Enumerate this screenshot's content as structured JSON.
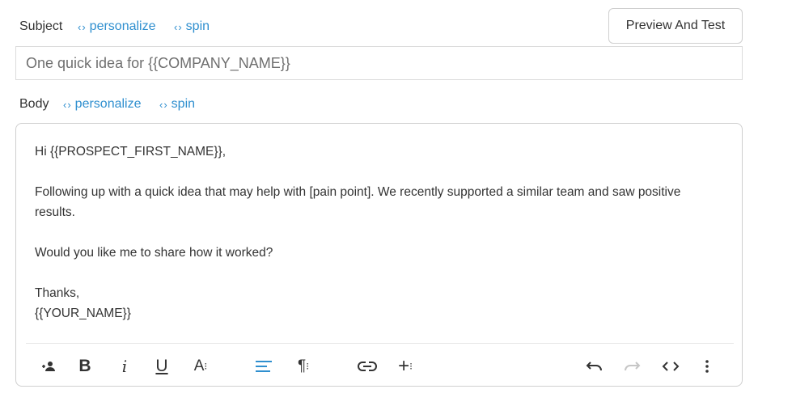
{
  "subject": {
    "label": "Subject",
    "personalize_label": "personalize",
    "spin_label": "spin",
    "value": "One quick idea for {{COMPANY_NAME}}"
  },
  "preview_button": {
    "label": "Preview And Test"
  },
  "body": {
    "label": "Body",
    "personalize_label": "personalize",
    "spin_label": "spin",
    "lines": [
      "Hi {{PROSPECT_FIRST_NAME}},",
      "Following up with a quick idea that may help with [pain point]. We recently supported a similar team and saw positive results.",
      "Would you like me to share how it worked?",
      "Thanks,",
      "{{YOUR_NAME}}"
    ]
  },
  "toolbar": {
    "icons": [
      "add-person-icon",
      "bold-icon",
      "italic-icon",
      "underline-icon",
      "font-size-icon",
      "align-left-icon",
      "paragraph-icon",
      "link-icon",
      "insert-icon",
      "undo-icon",
      "redo-icon",
      "code-view-icon",
      "more-icon"
    ],
    "accent_color": "#2f8fcf"
  },
  "colors": {
    "link": "#2f8fcf",
    "text": "#333333",
    "border": "#cfcfcf"
  }
}
